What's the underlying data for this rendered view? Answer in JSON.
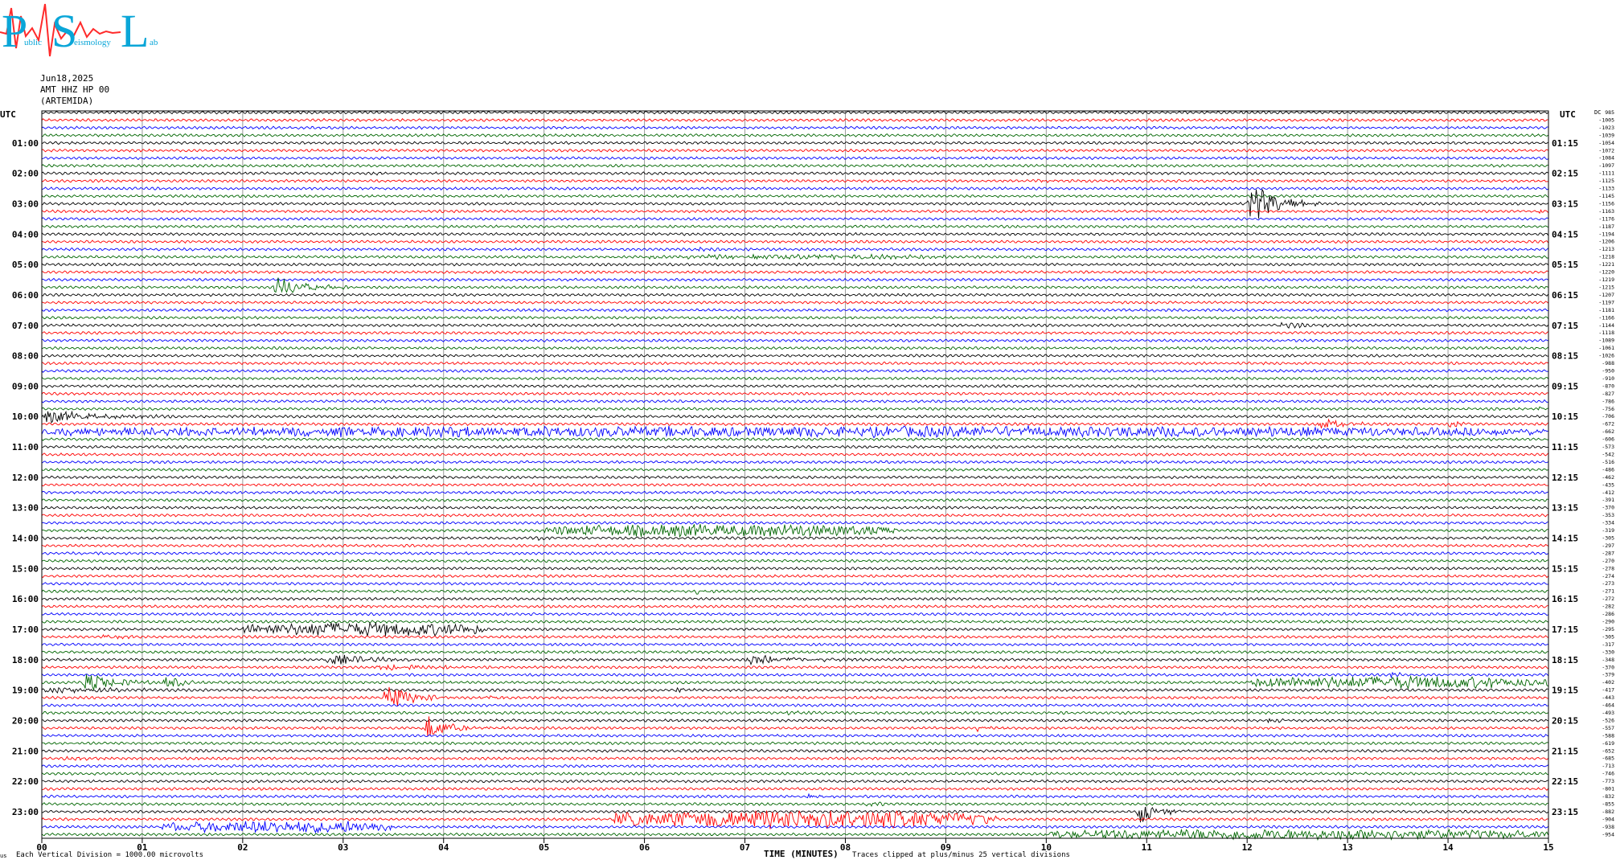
{
  "logo": {
    "letters": [
      "P",
      "S",
      "L"
    ],
    "subtitle": [
      "ublic",
      "eismology",
      "ab"
    ]
  },
  "header": {
    "date": "Jun18,2025",
    "station": "AMT HHZ HP 00",
    "location": "(ARTEMIDA)"
  },
  "left_axis_label": "UTC",
  "right_axis_label": "UTC",
  "dc_label": "DC",
  "footer": {
    "left_mark": "us",
    "scale_note": "Each Vertical Division = 1000.00 microvolts",
    "clip_note": "Traces clipped at plus/minus 25 vertical divisions"
  },
  "chart_data": {
    "type": "line",
    "title": "",
    "xlabel": "TIME (MINUTES)",
    "x_ticks": [
      "00",
      "01",
      "02",
      "03",
      "04",
      "05",
      "06",
      "07",
      "08",
      "09",
      "10",
      "11",
      "12",
      "13",
      "14",
      "15"
    ],
    "xlim": [
      0,
      15
    ],
    "left_hour_labels": [
      "01:00",
      "02:00",
      "03:00",
      "04:00",
      "05:00",
      "06:00",
      "07:00",
      "08:00",
      "09:00",
      "10:00",
      "11:00",
      "12:00",
      "13:00",
      "14:00",
      "15:00",
      "16:00",
      "17:00",
      "18:00",
      "19:00",
      "20:00",
      "21:00",
      "22:00",
      "23:00"
    ],
    "right_hour_labels": [
      "01:15",
      "02:15",
      "03:15",
      "04:15",
      "05:15",
      "06:15",
      "07:15",
      "08:15",
      "09:15",
      "10:15",
      "11:15",
      "12:15",
      "13:15",
      "14:15",
      "15:15",
      "16:15",
      "17:15",
      "18:15",
      "19:15",
      "20:15",
      "21:15",
      "22:15",
      "23:15"
    ],
    "trace_colors": [
      "#000000",
      "#ff0000",
      "#0000ff",
      "#006600"
    ],
    "traces_per_hour": 4,
    "trace_count": 96,
    "dc_offsets": [
      "985",
      "-1005",
      "-1023",
      "-1039",
      "-1054",
      "-1072",
      "-1084",
      "-1097",
      "-1111",
      "-1125",
      "-1133",
      "-1145",
      "-1156",
      "-1163",
      "-1176",
      "-1187",
      "-1194",
      "-1206",
      "-1213",
      "-1218",
      "-1221",
      "-1220",
      "-1219",
      "-1215",
      "-1207",
      "-1197",
      "-1181",
      "-1166",
      "-1144",
      "-1118",
      "-1089",
      "-1061",
      "-1026",
      "-988",
      "-950",
      "-910",
      "-870",
      "-827",
      "-786",
      "-756",
      "-706",
      "-672",
      "-662",
      "-606",
      "-573",
      "-542",
      "-516",
      "-486",
      "-462",
      "-435",
      "-412",
      "-391",
      "-370",
      "-353",
      "-334",
      "-319",
      "-305",
      "-297",
      "-287",
      "-270",
      "-278",
      "-274",
      "-273",
      "-271",
      "-272",
      "-282",
      "-286",
      "-290",
      "-295",
      "-305",
      "-317",
      "-330",
      "-348",
      "-370",
      "-379",
      "-402",
      "-417",
      "-443",
      "-464",
      "-493",
      "-526",
      "-557",
      "-588",
      "-619",
      "-652",
      "-685",
      "-713",
      "-746",
      "-773",
      "-801",
      "-832",
      "-855",
      "-882",
      "-904",
      "-938",
      "-954"
    ],
    "events": [
      {
        "trace": 1,
        "start": 2.8,
        "end": 2.9,
        "amp": 3
      },
      {
        "trace": 8,
        "start": 3.3,
        "end": 3.4,
        "amp": 2
      },
      {
        "trace": 9,
        "start": 9.9,
        "end": 10.3,
        "amp": 2
      },
      {
        "trace": 12,
        "start": 12.0,
        "end": 12.8,
        "amp": 32
      },
      {
        "trace": 13,
        "start": 14.9,
        "end": 15.0,
        "amp": 5
      },
      {
        "trace": 18,
        "start": 6.5,
        "end": 7.5,
        "amp": 2
      },
      {
        "trace": 19,
        "start": 6.0,
        "end": 9.0,
        "amp": 2
      },
      {
        "trace": 23,
        "start": 2.3,
        "end": 3.2,
        "amp": 14
      },
      {
        "trace": 25,
        "start": 3.8,
        "end": 4.0,
        "amp": 3
      },
      {
        "trace": 28,
        "start": 12.3,
        "end": 13.3,
        "amp": 4
      },
      {
        "trace": 39,
        "start": 14.9,
        "end": 15.0,
        "amp": 6
      },
      {
        "trace": 40,
        "start": 0.0,
        "end": 1.5,
        "amp": 9
      },
      {
        "trace": 42,
        "start": 2.4,
        "end": 3.2,
        "amp": 5
      },
      {
        "trace": 42,
        "start": 0.0,
        "end": 15.0,
        "amp": 6
      },
      {
        "trace": 41,
        "start": 12.7,
        "end": 13.5,
        "amp": 7
      },
      {
        "trace": 41,
        "start": 14.0,
        "end": 14.4,
        "amp": 6
      },
      {
        "trace": 55,
        "start": 5.0,
        "end": 8.5,
        "amp": 7
      },
      {
        "trace": 56,
        "start": 4.9,
        "end": 5.3,
        "amp": 3
      },
      {
        "trace": 63,
        "start": 6.5,
        "end": 6.9,
        "amp": 3
      },
      {
        "trace": 68,
        "start": 2.0,
        "end": 4.4,
        "amp": 8
      },
      {
        "trace": 69,
        "start": 0.6,
        "end": 1.2,
        "amp": 3
      },
      {
        "trace": 72,
        "start": 2.8,
        "end": 4.0,
        "amp": 8
      },
      {
        "trace": 72,
        "start": 7.0,
        "end": 8.6,
        "amp": 6
      },
      {
        "trace": 73,
        "start": 3.3,
        "end": 5.0,
        "amp": 4
      },
      {
        "trace": 74,
        "start": 10.7,
        "end": 11.0,
        "amp": 3
      },
      {
        "trace": 74,
        "start": 13.4,
        "end": 13.9,
        "amp": 4
      },
      {
        "trace": 75,
        "start": 0.4,
        "end": 1.3,
        "amp": 13
      },
      {
        "trace": 75,
        "start": 1.2,
        "end": 1.8,
        "amp": 10
      },
      {
        "trace": 75,
        "start": 12.0,
        "end": 15.0,
        "amp": 7
      },
      {
        "trace": 76,
        "start": 0.0,
        "end": 1.8,
        "amp": 5
      },
      {
        "trace": 76,
        "start": 6.3,
        "end": 6.6,
        "amp": 3
      },
      {
        "trace": 77,
        "start": 3.4,
        "end": 4.1,
        "amp": 22
      },
      {
        "trace": 77,
        "start": 4.4,
        "end": 4.8,
        "amp": 4
      },
      {
        "trace": 79,
        "start": 7.4,
        "end": 8.0,
        "amp": 3
      },
      {
        "trace": 81,
        "start": 3.8,
        "end": 4.5,
        "amp": 18
      },
      {
        "trace": 81,
        "start": 9.3,
        "end": 9.7,
        "amp": 5
      },
      {
        "trace": 80,
        "start": 12.2,
        "end": 12.6,
        "amp": 3
      },
      {
        "trace": 85,
        "start": 0.2,
        "end": 1.2,
        "amp": 2
      },
      {
        "trace": 86,
        "start": 11.1,
        "end": 11.4,
        "amp": 3
      },
      {
        "trace": 90,
        "start": 7.6,
        "end": 8.2,
        "amp": 3
      },
      {
        "trace": 91,
        "start": 8.2,
        "end": 8.8,
        "amp": 3
      },
      {
        "trace": 92,
        "start": 10.9,
        "end": 11.4,
        "amp": 20
      },
      {
        "trace": 93,
        "start": 5.7,
        "end": 9.5,
        "amp": 11
      },
      {
        "trace": 94,
        "start": 1.2,
        "end": 3.5,
        "amp": 7
      },
      {
        "trace": 95,
        "start": 10.0,
        "end": 15.0,
        "amp": 6
      }
    ]
  }
}
